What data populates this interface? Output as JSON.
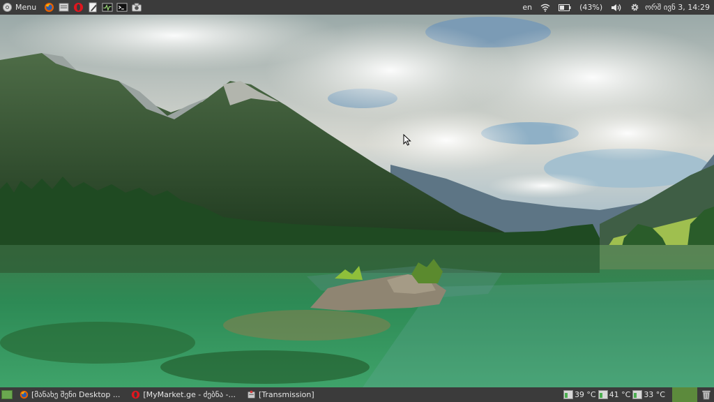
{
  "top_panel": {
    "menu_label": "Menu",
    "launchers": [
      {
        "name": "firefox-icon"
      },
      {
        "name": "file-manager-icon"
      },
      {
        "name": "opera-icon"
      },
      {
        "name": "text-editor-icon"
      },
      {
        "name": "system-monitor-icon"
      },
      {
        "name": "terminal-icon"
      },
      {
        "name": "screenshot-icon"
      }
    ],
    "keyboard_layout": "en",
    "battery_percent": "(43%)",
    "datetime": "ორშ ივნ 3, 14:29"
  },
  "bottom_panel": {
    "tasks": [
      {
        "title": "[მანახე შენი Desktop ..."
      },
      {
        "title": "[MyMarket.ge - ძებნა -..."
      },
      {
        "title": "[Transmission]"
      }
    ],
    "temps": [
      {
        "value": "39 °C"
      },
      {
        "value": "41 °C"
      },
      {
        "value": "33 °C"
      }
    ]
  },
  "colors": {
    "panel_bg": "#3b3b3b",
    "panel_text": "#e6e6e6",
    "workspace_active": "#5c8a3c"
  }
}
